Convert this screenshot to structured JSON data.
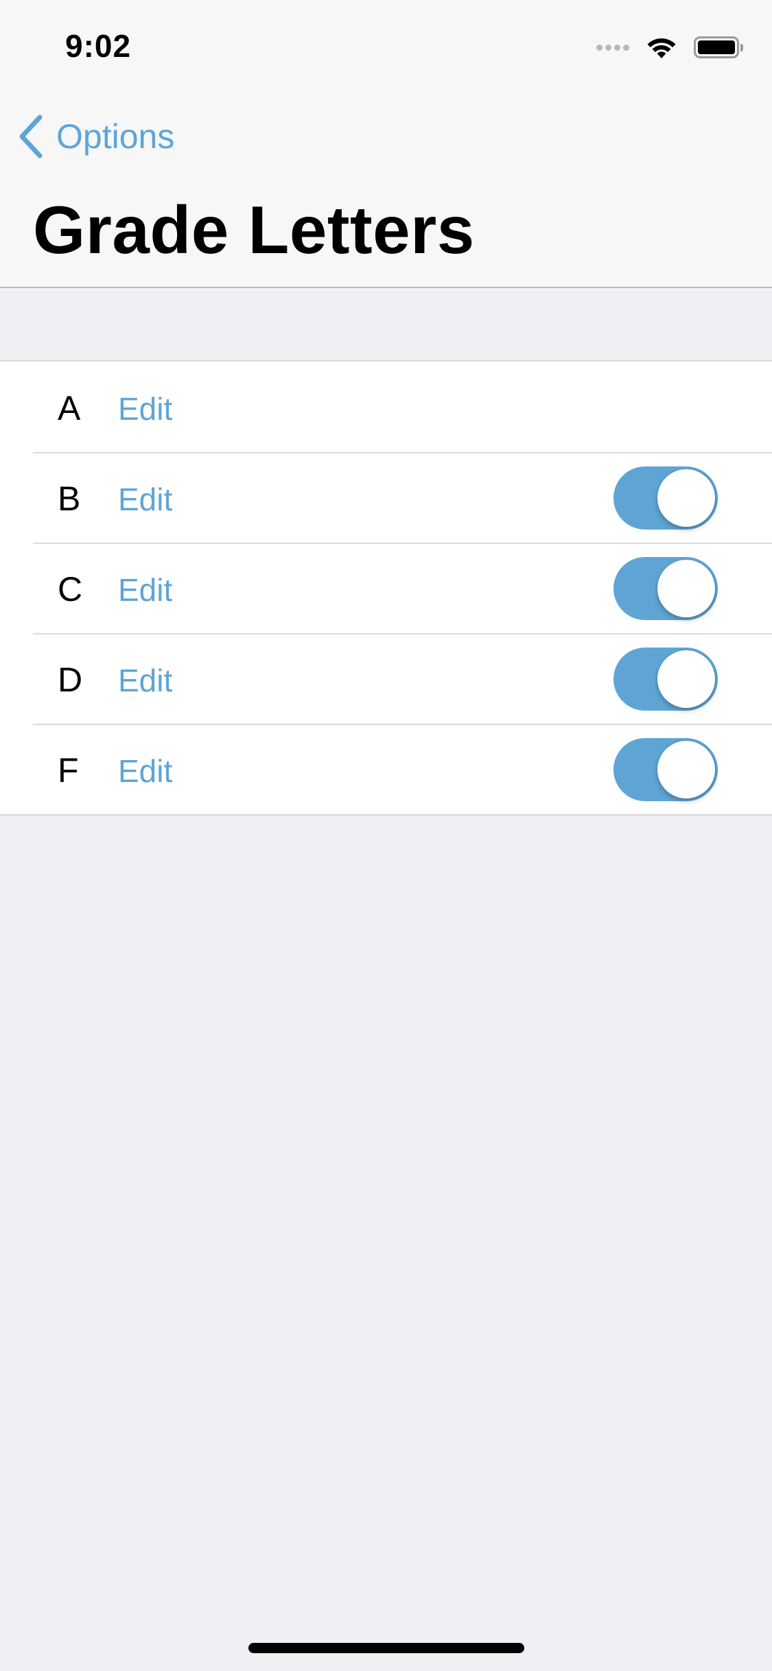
{
  "status_bar": {
    "time": "9:02",
    "icons": [
      "signal-dots-icon",
      "wifi-icon",
      "battery-icon"
    ]
  },
  "nav": {
    "back_label": "Options",
    "back_icon": "chevron-left-icon",
    "title": "Grade Letters"
  },
  "colors": {
    "accent": "#5ea5d6",
    "background": "#efeff4",
    "header_background": "#f7f7f8"
  },
  "grades": [
    {
      "letter": "A",
      "edit_label": "Edit",
      "has_toggle": false,
      "enabled": null
    },
    {
      "letter": "B",
      "edit_label": "Edit",
      "has_toggle": true,
      "enabled": true
    },
    {
      "letter": "C",
      "edit_label": "Edit",
      "has_toggle": true,
      "enabled": true
    },
    {
      "letter": "D",
      "edit_label": "Edit",
      "has_toggle": true,
      "enabled": true
    },
    {
      "letter": "F",
      "edit_label": "Edit",
      "has_toggle": true,
      "enabled": true
    }
  ]
}
